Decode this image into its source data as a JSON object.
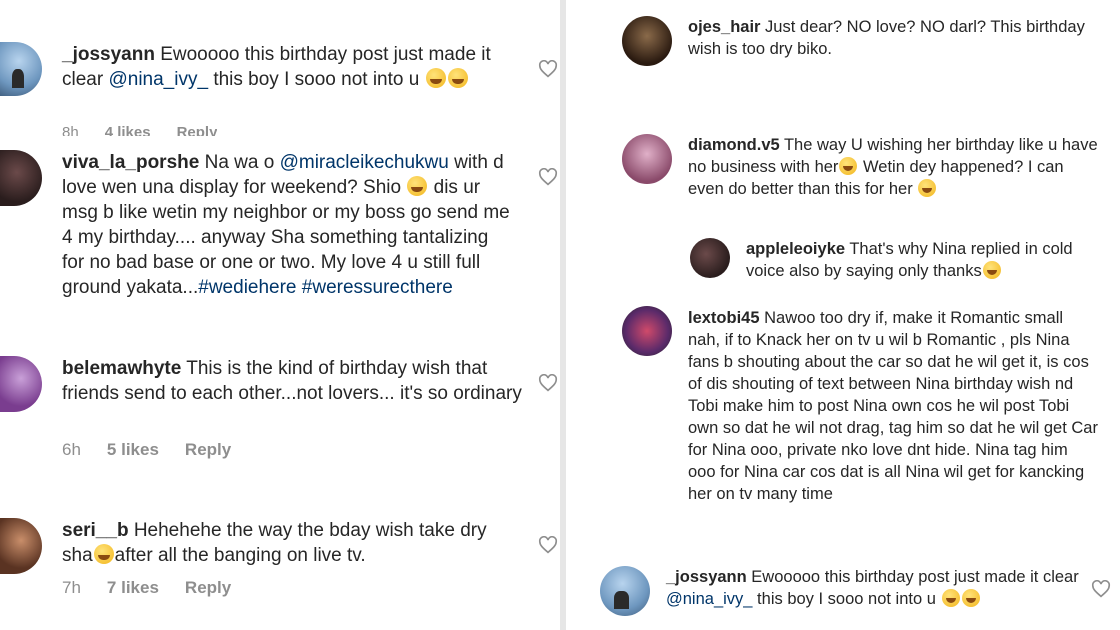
{
  "left": {
    "comments": [
      {
        "username": "_jossyann",
        "text_a": " Ewooooo this birthday post just made it clear ",
        "mention": "@nina_ivy_",
        "text_b": " this boy I sooo not into u",
        "time": "8h",
        "likes": "4 likes",
        "reply": "Reply"
      },
      {
        "username": "viva_la_porshe",
        "text_a": " Na wa o ",
        "mention": "@miracleikechukwu",
        "text_b": " with d love wen una display for weekend? Shio ",
        "text_c": " dis ur msg b like wetin my neighbor or my boss go send me 4 my birthday.... anyway Sha something tantalizing for no bad base or one or two. My love 4 u still full ground yakata...",
        "hashtags": "#wediehere #weressurecthere"
      },
      {
        "username": "belemawhyte",
        "text_a": " This is the kind of birthday wish that friends send to each other...not lovers... it's so ordinary",
        "time": "6h",
        "likes": "5 likes",
        "reply": "Reply"
      },
      {
        "username": "seri__b",
        "text_a": " Hehehehe the way the bday wish take dry sha",
        "text_b": "after all the banging on live tv.",
        "time": "7h",
        "likes": "7 likes",
        "reply": "Reply"
      }
    ]
  },
  "right": {
    "comments": [
      {
        "username": "ojes_hair",
        "text_a": " Just dear? NO love? NO darl? This birthday wish is too dry biko."
      },
      {
        "username": "diamond.v5",
        "text_a": " The way U wishing her birthday like u have no business with her",
        "text_b": " Wetin dey happened? I can even do better than this for her"
      },
      {
        "username": "appleleoiyke",
        "text_a": " That's why Nina replied in cold voice also by saying only thanks"
      },
      {
        "username": "lextobi45",
        "text_a": " Nawoo too dry if, make it Romantic small nah, if to Knack her on tv u wil b Romantic , pls Nina fans b shouting about the car so dat he wil get it, is cos of dis shouting of text between Nina birthday wish nd Tobi make him to post Nina own cos he wil post Tobi own so dat he wil not drag, tag him so dat he wil get Car for Nina ooo, private nko love dnt hide. Nina tag him ooo for Nina car cos dat is all Nina wil get for kancking her on tv many time"
      },
      {
        "username": "_jossyann",
        "text_a": " Ewooooo this birthday post just made it clear ",
        "mention": "@nina_ivy_",
        "text_b": " this boy I sooo not into u"
      }
    ]
  }
}
